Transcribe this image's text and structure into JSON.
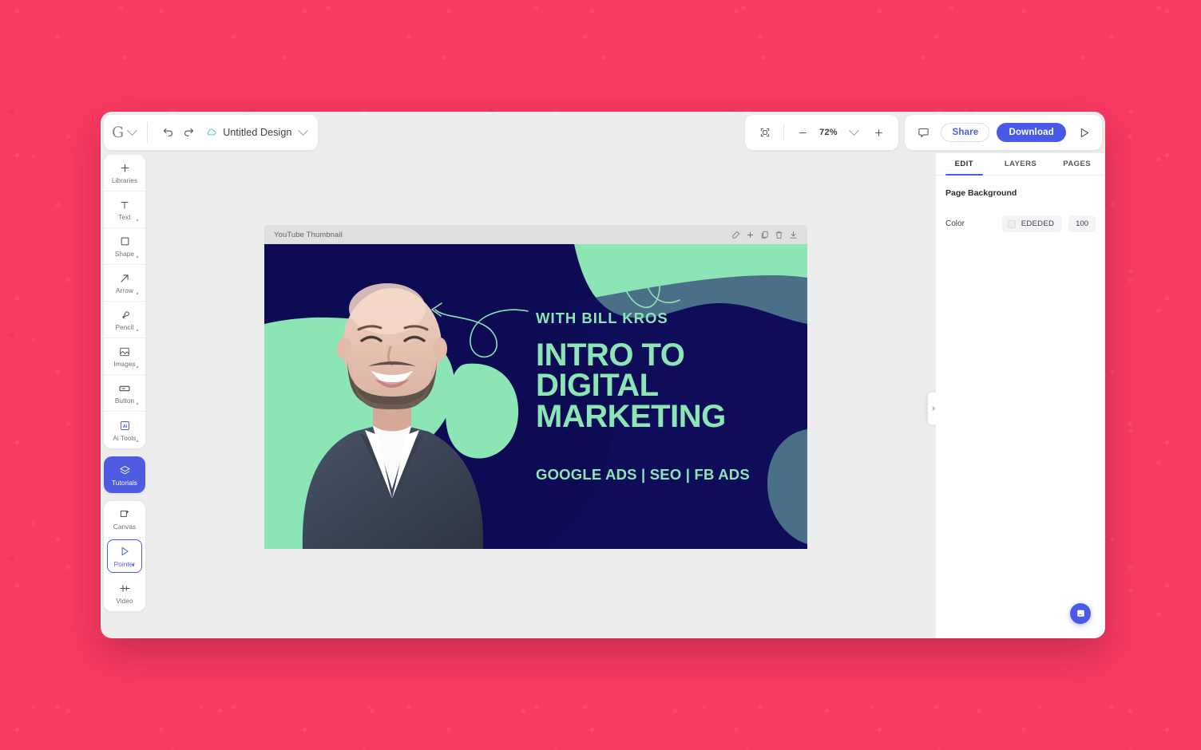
{
  "window": {
    "logo": "G",
    "logo_icon": "google-g-logo",
    "undo_icon": "undo-arrow-icon",
    "redo_icon": "redo-arrow-icon",
    "cloud_icon": "cloud-save-icon",
    "document_title": "Untitled Design",
    "title_chevron_icon": "chevron-down-icon"
  },
  "zoom": {
    "fit_icon": "fit-to-screen-icon",
    "minus_label": "—",
    "value": "72%",
    "chevron_icon": "chevron-down-icon",
    "plus_label": "+"
  },
  "actions": {
    "comment_icon": "comment-bubble-icon",
    "share_label": "Share",
    "download_label": "Download",
    "present_icon": "play-triangle-icon"
  },
  "toolbar": {
    "primary": [
      {
        "label": "Libraries",
        "icon": "plus-icon",
        "corner": false,
        "state": "default"
      },
      {
        "label": "Text",
        "icon": "text-t-icon",
        "corner": true,
        "state": "default"
      },
      {
        "label": "Shape",
        "icon": "square-icon",
        "corner": true,
        "state": "default"
      },
      {
        "label": "Arrow",
        "icon": "arrow-diagonal-icon",
        "corner": true,
        "state": "default"
      },
      {
        "label": "Pencil",
        "icon": "pencil-icon",
        "corner": true,
        "state": "default"
      },
      {
        "label": "Images",
        "icon": "image-icon",
        "corner": true,
        "state": "default"
      },
      {
        "label": "Button",
        "icon": "button-icon",
        "corner": true,
        "state": "default"
      },
      {
        "label": "Ai Tools",
        "icon": "ai-sparkle-icon",
        "corner": true,
        "state": "default"
      }
    ],
    "tutorials": {
      "label": "Tutorials",
      "icon": "layers-diamond-icon",
      "state": "active"
    },
    "secondary": [
      {
        "label": "Canvas",
        "icon": "canvas-frame-icon",
        "corner": false,
        "state": "default"
      },
      {
        "label": "Pointer",
        "icon": "pointer-cursor-icon",
        "corner": true,
        "state": "selected"
      },
      {
        "label": "Video",
        "icon": "video-timeline-icon",
        "corner": false,
        "state": "default"
      }
    ]
  },
  "artboard": {
    "name": "YouTube Thumbnail",
    "icons": [
      {
        "name": "edit-artboard-icon"
      },
      {
        "name": "add-artboard-icon"
      },
      {
        "name": "duplicate-artboard-icon"
      },
      {
        "name": "delete-artboard-icon"
      },
      {
        "name": "download-artboard-icon"
      }
    ]
  },
  "design": {
    "presenter": "WITH BILL KROS",
    "title_line1": "INTRO TO",
    "title_line2": "DIGITAL",
    "title_line3": "MARKETING",
    "subtitle": "GOOGLE ADS | SEO | FB ADS",
    "colors": {
      "background": "#0D0B54",
      "accent_mint": "#8CE5B5",
      "text": "#8CE5B5"
    }
  },
  "panel": {
    "tabs": [
      {
        "label": "EDIT",
        "active": true
      },
      {
        "label": "LAYERS",
        "active": false
      },
      {
        "label": "PAGES",
        "active": false
      }
    ],
    "section_title": "Page Background",
    "color_row_label": "Color",
    "color_hex": "EDEDED",
    "opacity": "100",
    "collapse_icon": "chevron-right-icon",
    "chat_icon": "support-chat-icon"
  },
  "theme": {
    "page_pink": "#FB3A62",
    "accent_blue": "#4A5AE8",
    "tutorials_blue": "#4F5BE0",
    "workspace_gray": "#EDEDED"
  }
}
